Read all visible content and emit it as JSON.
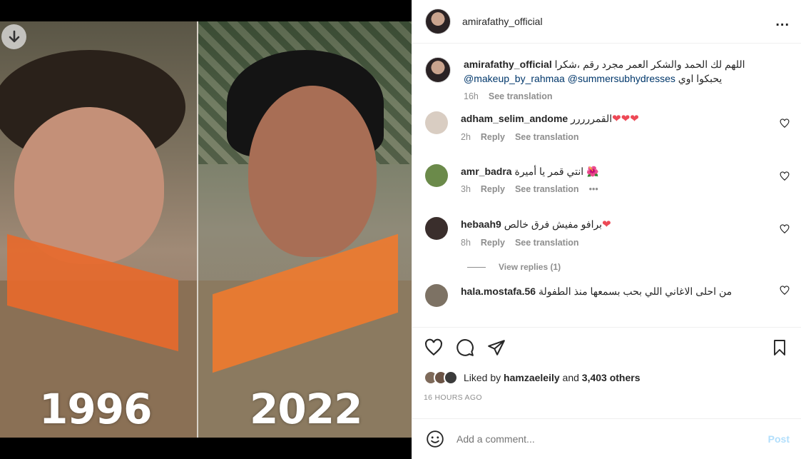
{
  "media": {
    "year_left": "1996",
    "year_right": "2022"
  },
  "post": {
    "username": "amirafathy_official",
    "more_icon": "..."
  },
  "caption": {
    "username": "amirafathy_official",
    "text": "اللهم لك الحمد والشكر العمر مجرد رقم ،شكرا",
    "mention1": "@makeup_by_rahmaa",
    "mention2": "@summersubhydresses",
    "text2": "يحبكوا اوي",
    "time": "16h",
    "see_translation": "See translation"
  },
  "comments": [
    {
      "username": "adham_selim_andome",
      "text": "القمررررر",
      "hearts": "❤❤❤",
      "time": "2h",
      "reply": "Reply",
      "see_translation": "See translation"
    },
    {
      "username": "amr_badra",
      "text": "انتي قمر يا أميرة",
      "emoji": "🌺",
      "time": "3h",
      "reply": "Reply",
      "see_translation": "See translation",
      "more": "•••"
    },
    {
      "username": "hebaah9",
      "text": "برافو مفيش فرق خالص",
      "hearts": "❤",
      "time": "8h",
      "reply": "Reply",
      "see_translation": "See translation",
      "view_replies": "View replies (1)"
    },
    {
      "username": "hala.mostafa.56",
      "text": "من احلى الاغاني اللي بحب بسمعها منذ الطفولة"
    }
  ],
  "likes": {
    "prefix": "Liked by",
    "user": "hamzaeleily",
    "and": "and",
    "others": "3,403 others"
  },
  "timestamp": "16 HOURS AGO",
  "add_comment": {
    "placeholder": "Add a comment...",
    "post": "Post"
  },
  "colors": {
    "accent_blue": "#0095f6",
    "post_disabled": "#b2dffc",
    "heart_red": "#ed4956",
    "mention": "#00376b"
  }
}
